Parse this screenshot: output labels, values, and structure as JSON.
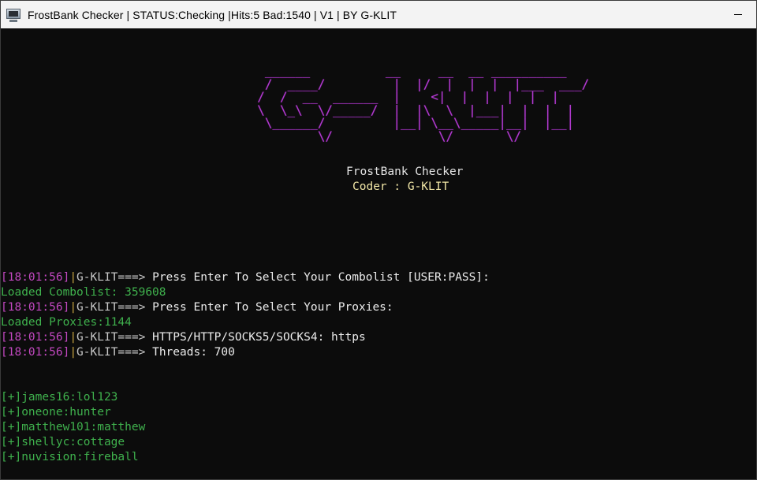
{
  "window": {
    "title": "FrostBank Checker | STATUS:Checking |Hits:5 Bad:1540 | V1 | BY G-KLIT",
    "icon": "console-app-icon",
    "minimize_icon": "minimize-icon"
  },
  "banner": {
    "ascii_lines": [
      "                                   ______          __     __  __ __________",
      "                                   /  ____/         |  |/  |  |  |  |___  ___/",
      "                                  /  /  __  ______  |    <|  |  |  |  |  |",
      "                                  \\  \\_\\  \\/_____/  |  |\\  \\  |___|  |  |  |",
      "                                   \\______/         |__| \\__\\_____|__|  |__|",
      "                                          \\/              \\/       \\/"
    ],
    "title": "FrostBank Checker",
    "coder": "Coder : G-KLIT"
  },
  "log": [
    {
      "timestamp": "[18:01:56]",
      "sep": "|",
      "name": "G-KLIT===>",
      "message": " Press Enter To Select Your Combolist [USER:PASS]:"
    },
    {
      "status": "Loaded Combolist: 359608"
    },
    {
      "timestamp": "[18:01:56]",
      "sep": "|",
      "name": "G-KLIT===>",
      "message": " Press Enter To Select Your Proxies:"
    },
    {
      "status": "Loaded Proxies:1144"
    },
    {
      "timestamp": "[18:01:56]",
      "sep": "|",
      "name": "G-KLIT===>",
      "message": " HTTPS/HTTP/SOCKS5/SOCKS4: https"
    },
    {
      "timestamp": "[18:01:56]",
      "sep": "|",
      "name": "G-KLIT===>",
      "message": " Threads: 700"
    }
  ],
  "hits": [
    "[+]james16:lol123",
    "[+]oneone:hunter",
    "[+]matthew101:matthew",
    "[+]shellyc:cottage",
    "[+]nuvision:fireball"
  ],
  "colors": {
    "background": "#0c0c0c",
    "banner": "#b23bd0",
    "timestamp": "#c248c0",
    "success": "#3fb14d",
    "coder": "#f1e6a6"
  }
}
